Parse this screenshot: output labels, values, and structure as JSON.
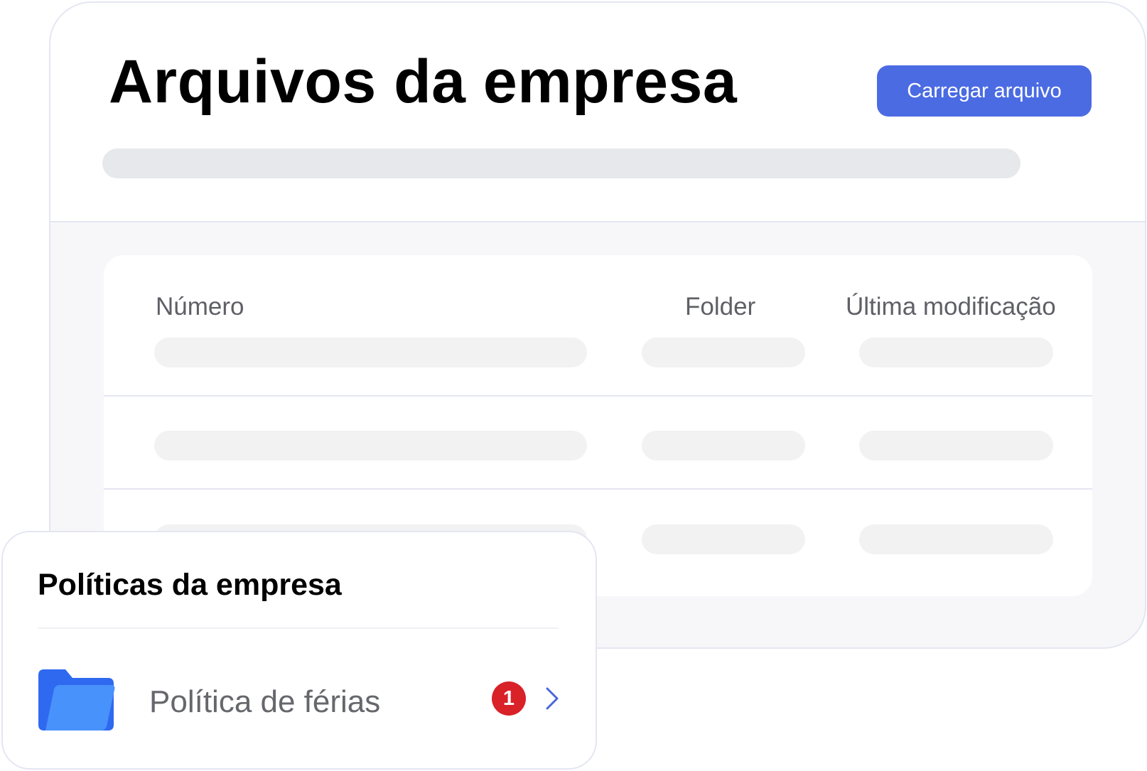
{
  "header": {
    "title": "Arquivos da empresa",
    "upload_label": "Carregar arquivo"
  },
  "table": {
    "columns": [
      "Número",
      "Folder",
      "Última modificação"
    ]
  },
  "policies": {
    "title": "Políticas da empresa",
    "items": [
      {
        "label": "Política de férias",
        "badge": "1",
        "icon": "folder-icon",
        "action_icon": "chevron-right-icon"
      }
    ]
  },
  "colors": {
    "accent": "#4b6be3",
    "badge": "#d92128",
    "folder": "#3f7af5"
  }
}
